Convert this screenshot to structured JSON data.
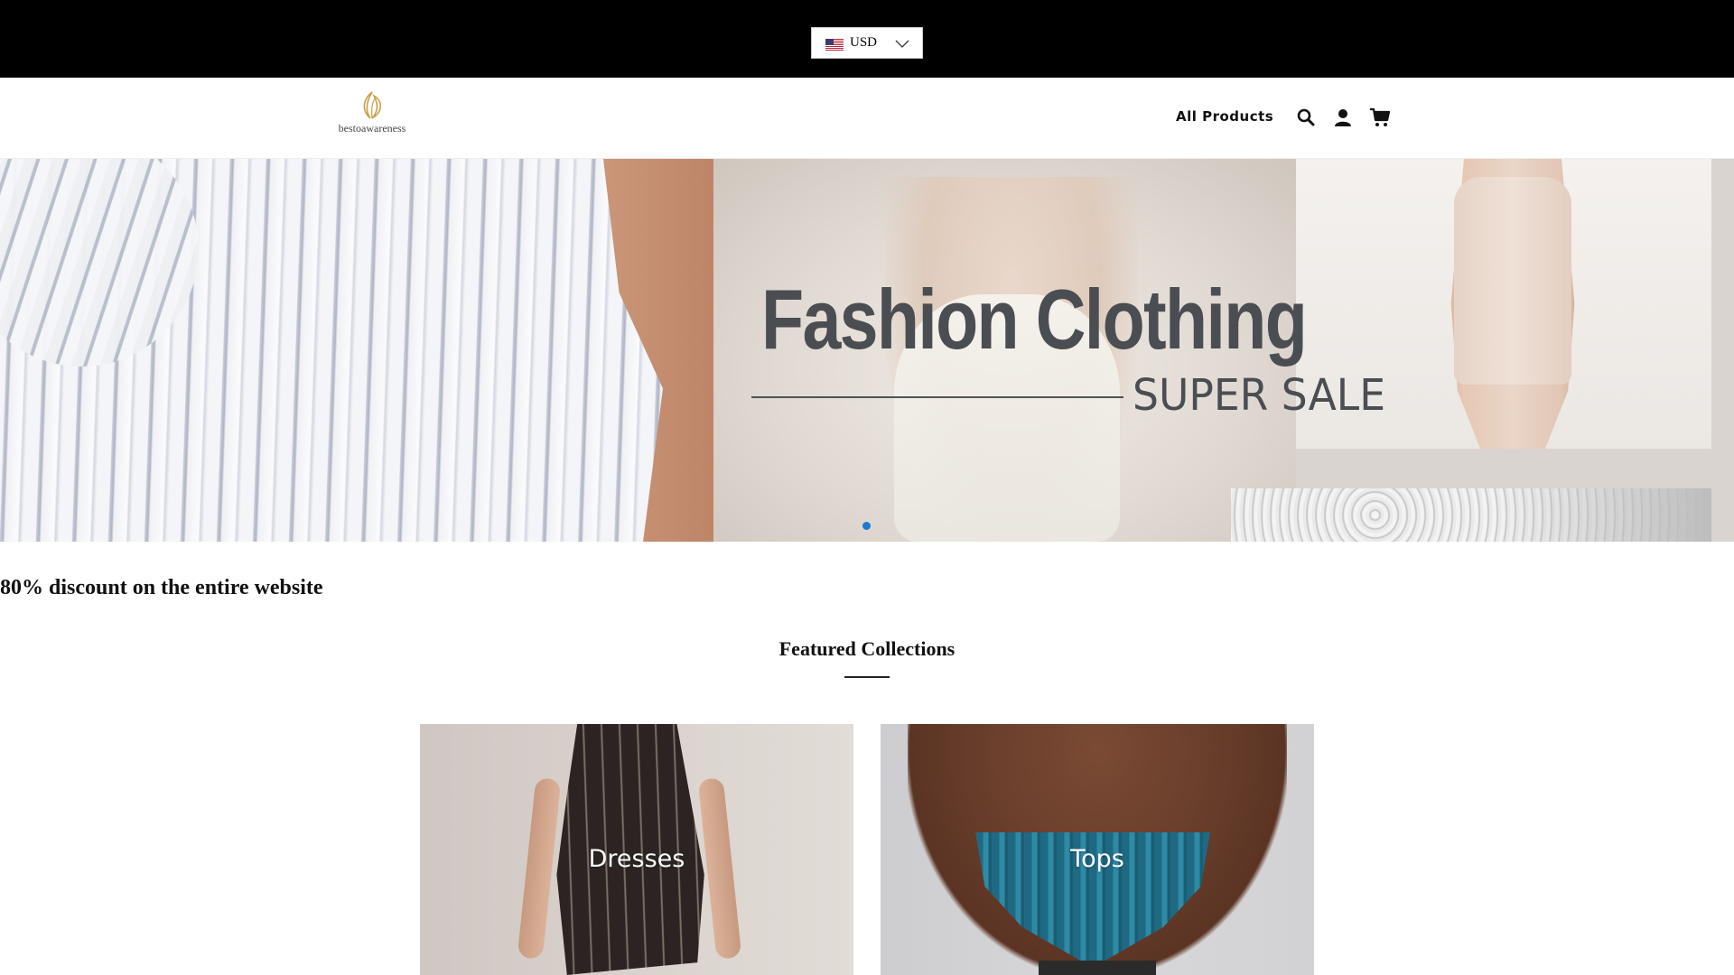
{
  "topbar": {
    "currency": {
      "code": "USD",
      "flag_icon": "us-flag-icon",
      "chevron_icon": "chevron-down-icon"
    }
  },
  "header": {
    "logo_text": "bestoawareness",
    "logo_color": "#c9a04a",
    "nav": {
      "all_products": "All Products"
    },
    "icons": [
      "search-icon",
      "user-icon",
      "cart-icon"
    ]
  },
  "hero": {
    "title": "Fashion Clothing",
    "subtitle": "SUPER SALE",
    "active_slide": 1,
    "slide_count": 1,
    "dot_color": "#1c79d6"
  },
  "announcement": "80% discount on the entire website",
  "featured": {
    "title": "Featured Collections",
    "collections": [
      {
        "label": "Dresses"
      },
      {
        "label": "Tops"
      }
    ]
  }
}
